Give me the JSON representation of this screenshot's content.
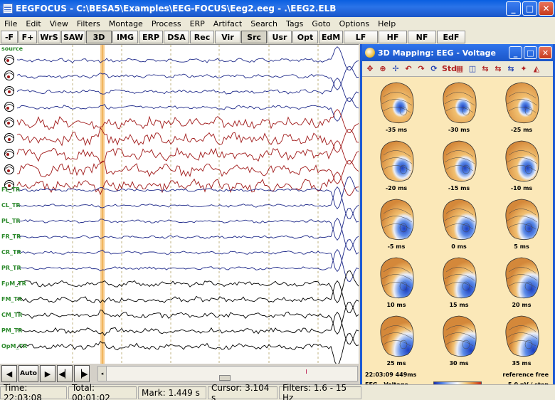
{
  "window": {
    "title": "EEGFOCUS - C:\\BESA5\\Examples\\EEG-FOCUS\\Eeg2.eeg - .\\EEG2.ELB",
    "buttons": {
      "minimize": "_",
      "maximize": "□",
      "close": "✕"
    }
  },
  "menu": [
    "File",
    "Edit",
    "View",
    "Filters",
    "Montage",
    "Process",
    "ERP",
    "Artifact",
    "Search",
    "Tags",
    "Goto",
    "Options",
    "Help"
  ],
  "toolbar": [
    {
      "label": "-F",
      "w": 24,
      "active": false
    },
    {
      "label": "F+",
      "w": 26,
      "active": false
    },
    {
      "label": "WrS",
      "w": 32,
      "active": false
    },
    {
      "label": "SAW",
      "w": 34,
      "active": false
    },
    {
      "label": "3D",
      "w": 36,
      "active": true
    },
    {
      "label": "IMG",
      "w": 36,
      "active": false
    },
    {
      "label": "ERP",
      "w": 34,
      "active": false
    },
    {
      "label": "DSA",
      "w": 36,
      "active": false
    },
    {
      "label": "Rec",
      "w": 34,
      "active": false
    },
    {
      "label": "Vir",
      "w": 36,
      "active": false
    },
    {
      "label": "Src",
      "w": 36,
      "active": true
    },
    {
      "label": "Usr",
      "w": 34,
      "active": false
    },
    {
      "label": "Opt",
      "w": 36,
      "active": false
    },
    {
      "label": "EdM",
      "w": 34,
      "active": false
    },
    {
      "label": "LF",
      "w": 48,
      "active": false
    },
    {
      "label": "HF",
      "w": 40,
      "active": false
    },
    {
      "label": "NF",
      "w": 40,
      "active": false
    },
    {
      "label": "EdF",
      "w": 40,
      "active": false
    }
  ],
  "eeg": {
    "source_label": "source",
    "channels": [
      "FL_TR",
      "CL_TR",
      "PL_TR",
      "FR_TR",
      "CR_TR",
      "PR_TR",
      "FpM_TR",
      "FM_TR",
      "CM_TR",
      "PM_TR",
      "OpM_TR"
    ],
    "colors": {
      "trace_blue": "#1f2a8a",
      "trace_red": "#a01818",
      "trace_black": "#000000",
      "label_green": "#2c8a2c",
      "cursor_orange": "#f5b860",
      "cursor_line": "#e9a030"
    }
  },
  "map": {
    "title": "3D Mapping: EEG - Voltage",
    "tools": [
      "✥",
      "⊕",
      "✢",
      "↶",
      "↷",
      "⟳",
      "Std",
      "▦",
      "◫",
      "⇆",
      "⇆",
      "⇆",
      "✦",
      "◭"
    ],
    "times": [
      "-35 ms",
      "-30 ms",
      "-25 ms",
      "-20 ms",
      "-15 ms",
      "-10 ms",
      "-5 ms",
      "0 ms",
      "5 ms",
      "10 ms",
      "15 ms",
      "20 ms",
      "25 ms",
      "30 ms",
      "35 ms"
    ],
    "footer_left_1": "22:03:09 449ms",
    "footer_left_2": "EEG - Voltage",
    "footer_right_1": "reference free",
    "footer_right_2": "5.0 pV / step"
  },
  "controls": {
    "auto_label": "Auto",
    "first": "◀",
    "play": "▶",
    "back": "◀▏",
    "forward": "▕▶"
  },
  "status": {
    "time": "Time: 22:03:08",
    "total": "Total: 00:01:02",
    "mark": "Mark: 1.449 s",
    "cursor": "Cursor: 3.104 s",
    "filters": "Filters: 1.6 - 15 Hz"
  }
}
